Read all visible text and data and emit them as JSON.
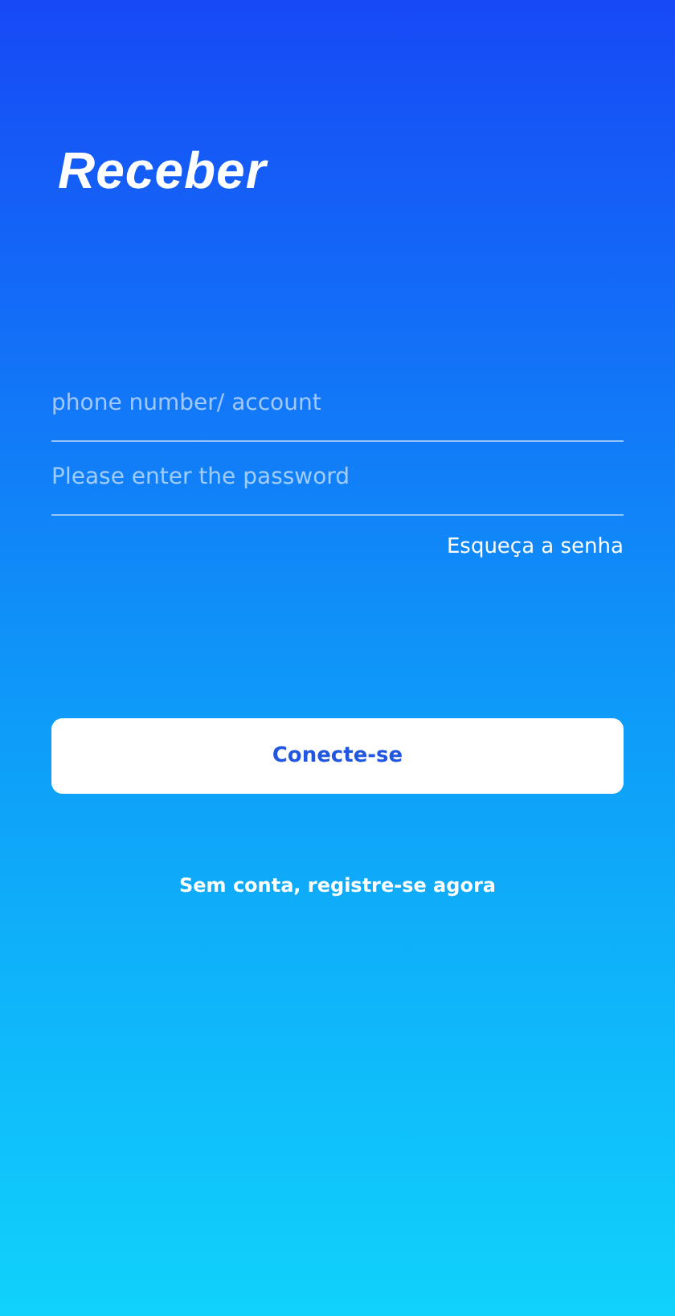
{
  "app": {
    "title": "Receber"
  },
  "login_form": {
    "fields": [
      {
        "placeholder": "phone number/ account"
      },
      {
        "placeholder": "Please enter the password"
      }
    ],
    "forgot_link": "Esqueça a senha",
    "submit_button": "Conecte-se",
    "register_link": "Sem conta, registre-se agora"
  }
}
